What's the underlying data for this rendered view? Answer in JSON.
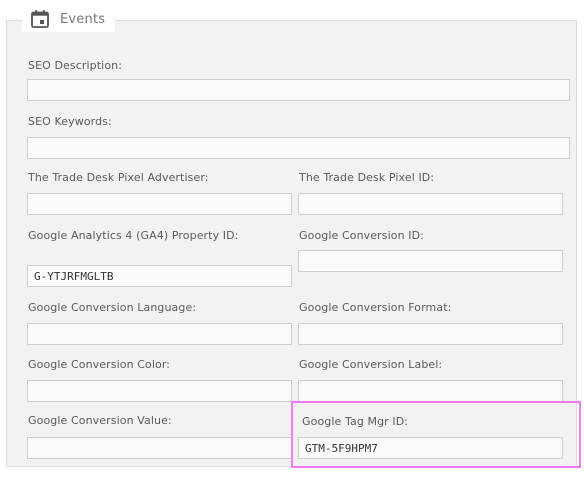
{
  "section": {
    "title": "Events",
    "icon": "calendar-icon"
  },
  "fields": {
    "seo_description": {
      "label": "SEO Description:",
      "value": ""
    },
    "seo_keywords": {
      "label": "SEO Keywords:",
      "value": ""
    },
    "ttd_advertiser": {
      "label": "The Trade Desk Pixel Advertiser:",
      "value": ""
    },
    "ttd_pixel_id": {
      "label": "The Trade Desk Pixel ID:",
      "value": ""
    },
    "ga4_property_id": {
      "label": "Google Analytics 4 (GA4) Property ID:",
      "value": "G-YTJRFMGLTB"
    },
    "gconv_id": {
      "label": "Google Conversion ID:",
      "value": ""
    },
    "gconv_language": {
      "label": "Google Conversion Language:",
      "value": ""
    },
    "gconv_format": {
      "label": "Google Conversion Format:",
      "value": ""
    },
    "gconv_color": {
      "label": "Google Conversion Color:",
      "value": ""
    },
    "gconv_label": {
      "label": "Google Conversion Label:",
      "value": ""
    },
    "gconv_value": {
      "label": "Google Conversion Value:",
      "value": ""
    },
    "gtm_id": {
      "label": "Google Tag Mgr ID:",
      "value": "GTM-5F9HPM7"
    }
  },
  "colors": {
    "highlight": "#f27af2",
    "panel_bg": "#f2f2f2",
    "field_border": "#cfcfcf"
  }
}
